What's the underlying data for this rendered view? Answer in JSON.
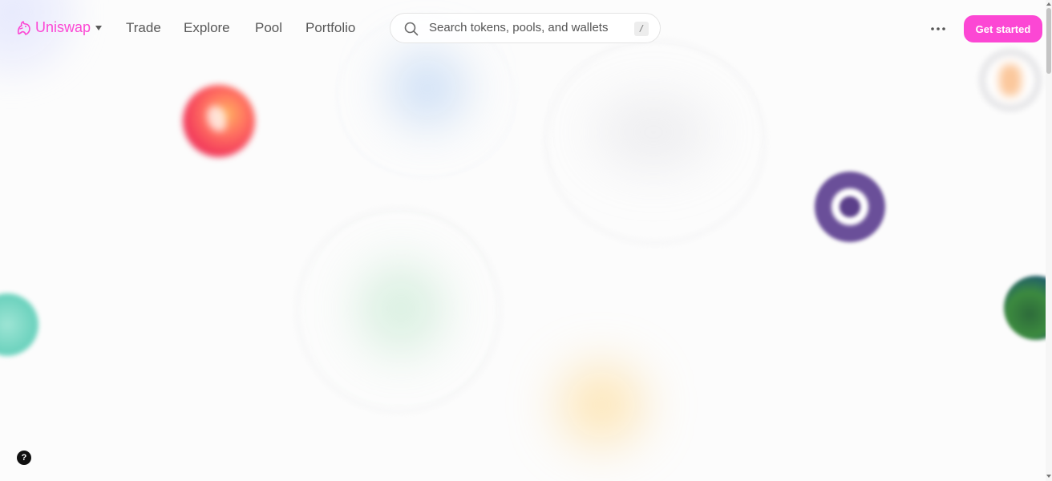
{
  "brand": {
    "name": "Uniswap",
    "accent_color": "#fc47d4"
  },
  "nav": {
    "items": [
      {
        "label": "Trade"
      },
      {
        "label": "Explore"
      },
      {
        "label": "Pool"
      },
      {
        "label": "Portfolio"
      }
    ]
  },
  "search": {
    "placeholder": "Search tokens, pools, and wallets",
    "shortcut": "/"
  },
  "header": {
    "more_icon": "ellipsis-icon",
    "cta_label": "Get started"
  },
  "help": {
    "label": "?"
  },
  "background_tokens": [
    {
      "icon": "red-token-icon",
      "color": "#f4405c"
    },
    {
      "icon": "purple-token-icon",
      "color": "#5b3f8a"
    },
    {
      "icon": "bitcoin-token-icon",
      "color": "#f7931a"
    },
    {
      "icon": "teal-token-icon",
      "color": "#6fd3bf"
    },
    {
      "icon": "green-token-icon",
      "color": "#3c8a3f"
    },
    {
      "icon": "blue-blur",
      "color": "#a0c3f0"
    },
    {
      "icon": "yellow-blur",
      "color": "#ffd278"
    },
    {
      "icon": "mint-blur",
      "color": "#a0dcb4"
    }
  ]
}
